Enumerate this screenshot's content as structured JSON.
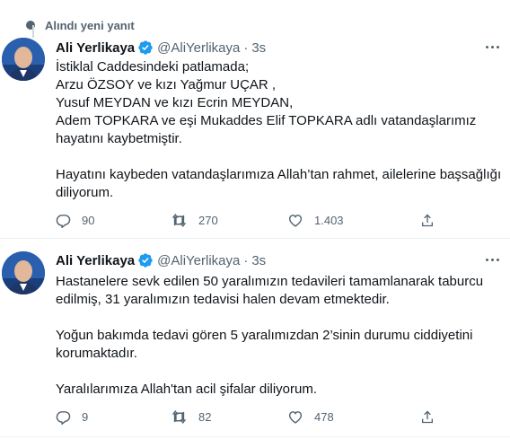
{
  "notice": {
    "text": "Alındı yeni yanıt",
    "icon": "dot-icon"
  },
  "colors": {
    "verified": "#1d9bf0",
    "secondary": "#536471",
    "text": "#0f1419"
  },
  "tweets": [
    {
      "name": "Ali Yerlikaya",
      "handle": "@AliYerlikaya",
      "time": "3s",
      "lines": [
        "İstiklal Caddesindeki patlamada;",
        "Arzu ÖZSOY ve kızı Yağmur UÇAR ,",
        "Yusuf MEYDAN ve kızı Ecrin MEYDAN,",
        "Adem TOPKARA ve eşi Mukaddes Elif TOPKARA adlı vatandaşlarımız",
        "hayatını kaybetmiştir.",
        "",
        "Hayatını kaybeden vatandaşlarımıza Allah’tan rahmet, ailelerine başsağlığı",
        "diliyorum."
      ],
      "replies": "90",
      "retweets": "270",
      "likes": "1.403"
    },
    {
      "name": "Ali Yerlikaya",
      "handle": "@AliYerlikaya",
      "time": "3s",
      "lines": [
        "Hastanelere sevk edilen 50 yaralımızın tedavileri tamamlanarak taburcu",
        "edilmiş, 31 yaralımızın tedavisi halen devam etmektedir.",
        "",
        "Yoğun bakımda tedavi gören 5 yaralımızdan 2’sinin durumu ciddiyetini",
        "korumaktadır.",
        "",
        "Yaralılarımıza Allah'tan acil şifalar diliyorum."
      ],
      "replies": "9",
      "retweets": "82",
      "likes": "478"
    }
  ]
}
